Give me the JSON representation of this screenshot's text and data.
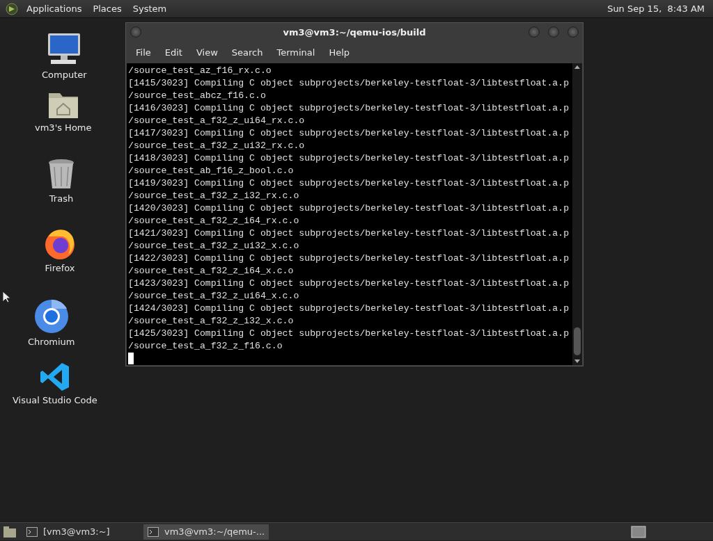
{
  "top_panel": {
    "menus": [
      "Applications",
      "Places",
      "System"
    ],
    "clock": "Sun Sep 15,  8:43 AM"
  },
  "desktop_icons": [
    {
      "kind": "computer",
      "label": "Computer"
    },
    {
      "kind": "home",
      "label": "vm3's Home"
    },
    {
      "kind": "trash",
      "label": "Trash"
    },
    {
      "kind": "firefox",
      "label": "Firefox"
    },
    {
      "kind": "chromium",
      "label": "Chromium"
    },
    {
      "kind": "vscode",
      "label": "Visual Studio Code"
    }
  ],
  "window": {
    "title": "vm3@vm3:~/qemu-ios/build",
    "menu": [
      "File",
      "Edit",
      "View",
      "Search",
      "Terminal",
      "Help"
    ],
    "lines": [
      "/source_test_az_f16_rx.c.o",
      "[1415/3023] Compiling C object subprojects/berkeley-testfloat-3/libtestfloat.a.p",
      "/source_test_abcz_f16.c.o",
      "[1416/3023] Compiling C object subprojects/berkeley-testfloat-3/libtestfloat.a.p",
      "/source_test_a_f32_z_ui64_rx.c.o",
      "[1417/3023] Compiling C object subprojects/berkeley-testfloat-3/libtestfloat.a.p",
      "/source_test_a_f32_z_ui32_rx.c.o",
      "[1418/3023] Compiling C object subprojects/berkeley-testfloat-3/libtestfloat.a.p",
      "/source_test_ab_f16_z_bool.c.o",
      "[1419/3023] Compiling C object subprojects/berkeley-testfloat-3/libtestfloat.a.p",
      "/source_test_a_f32_z_i32_rx.c.o",
      "[1420/3023] Compiling C object subprojects/berkeley-testfloat-3/libtestfloat.a.p",
      "/source_test_a_f32_z_i64_rx.c.o",
      "[1421/3023] Compiling C object subprojects/berkeley-testfloat-3/libtestfloat.a.p",
      "/source_test_a_f32_z_ui32_x.c.o",
      "[1422/3023] Compiling C object subprojects/berkeley-testfloat-3/libtestfloat.a.p",
      "/source_test_a_f32_z_i64_x.c.o",
      "[1423/3023] Compiling C object subprojects/berkeley-testfloat-3/libtestfloat.a.p",
      "/source_test_a_f32_z_ui64_x.c.o",
      "[1424/3023] Compiling C object subprojects/berkeley-testfloat-3/libtestfloat.a.p",
      "/source_test_a_f32_z_i32_x.c.o",
      "[1425/3023] Compiling C object subprojects/berkeley-testfloat-3/libtestfloat.a.p",
      "/source_test_a_f32_z_f16.c.o"
    ]
  },
  "taskbar": [
    {
      "label": "[vm3@vm3:~]",
      "selected": false
    },
    {
      "label": "vm3@vm3:~/qemu-...",
      "selected": true
    }
  ]
}
